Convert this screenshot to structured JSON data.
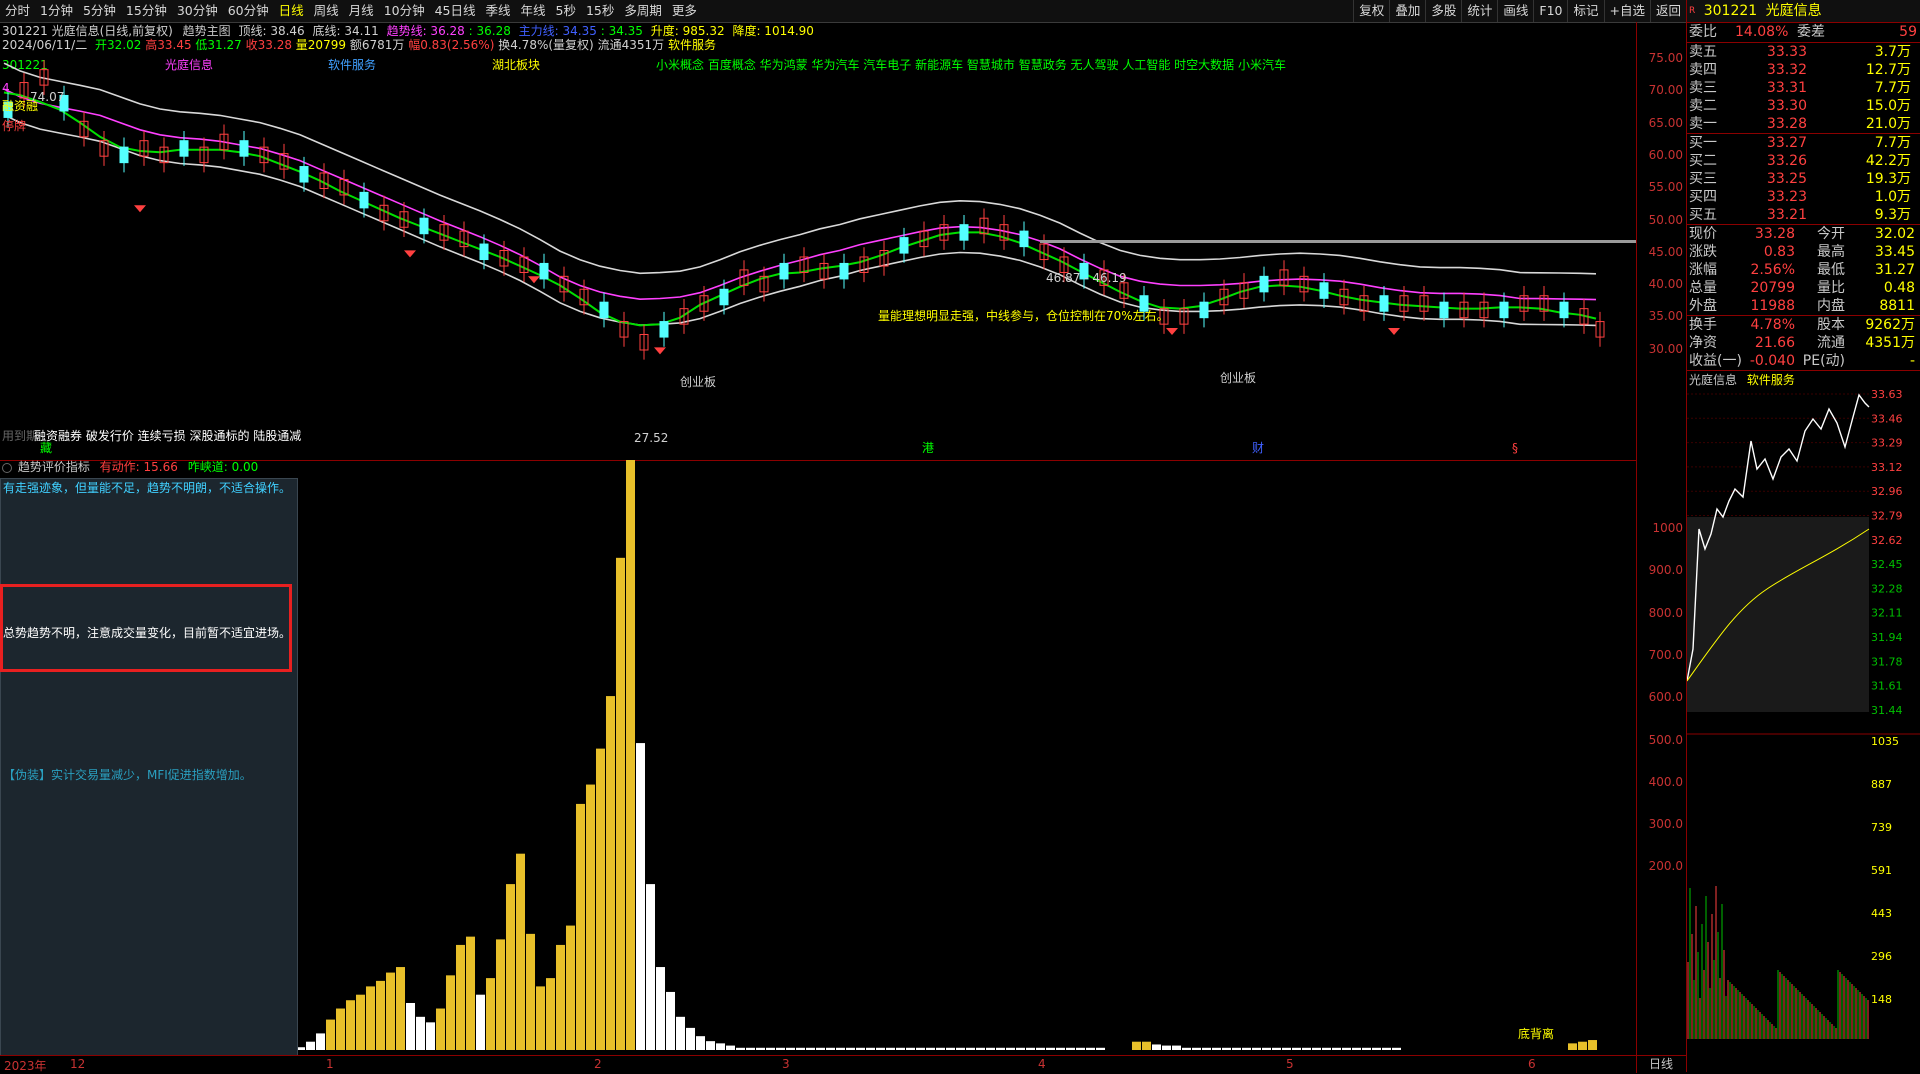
{
  "toolbar": {
    "periods": [
      "分时",
      "1分钟",
      "5分钟",
      "15分钟",
      "30分钟",
      "60分钟",
      "日线",
      "周线",
      "月线",
      "10分钟",
      "45日线",
      "季线",
      "年线",
      "5秒",
      "15秒",
      "多周期",
      "更多"
    ],
    "active_period": "日线",
    "right_buttons": [
      "复权",
      "叠加",
      "多股",
      "统计",
      "画线",
      "F10",
      "标记",
      "+自选",
      "返回"
    ]
  },
  "info": {
    "line1": {
      "code_name": "301221 光庭信息(日线,前复权)",
      "indicator": "趋势主图",
      "top_line": "顶线: 38.46",
      "bottom_line": "底线: 34.11",
      "trend_line": "趋势线: 36.28",
      "trend_line2": ": 36.28",
      "main_line": "主力线: 34.35",
      "main_line2": ": 34.35",
      "up_stop": "升度: 985.32",
      "down_stop": "降度: 1014.90"
    },
    "line2": {
      "date": "2024/06/11/二",
      "open": "开32.02",
      "high": "高33.45",
      "low": "低31.27",
      "close": "收33.28",
      "vol": "量20799",
      "amount": "额6781万",
      "change": "幅0.83(2.56%)",
      "turnover": "换4.78%(量复权)",
      "float": "流通4351万",
      "sector": "软件服务"
    },
    "tags_row": {
      "code": "301221",
      "name": "光庭信息",
      "sector": "软件服务",
      "region": "湖北板块",
      "concepts": "小米概念 百度概念 华为鸿蒙 华为汽车 汽车电子 新能源车 智慧城市 智慧政务 无人驾驶 人工智能 时空大数据 小米汽车"
    }
  },
  "chart_labels": {
    "high_mark": "74.07",
    "low_mark": "27.52",
    "range_mark": "46.87 - 46.19",
    "note1": "创业板",
    "note2": "创业板",
    "note3": "创业板",
    "tip_yellow": "量能理想明显走强，中线参与，仓位控制在70%左右。",
    "left_tag1": "融资融",
    "left_tag2": "停牌",
    "bottom_tags": "融资融券 破发行价 连续亏损 深股通标的 陆股通减",
    "bottom_tag_prefix": "用到期",
    "bottom_hk": "港",
    "bottom_cai": "财",
    "bottom_s": "§",
    "bottom_zang": "藏",
    "bottom_left_num": "4"
  },
  "price_axis": [
    "75.00",
    "70.00",
    "65.00",
    "60.00",
    "55.00",
    "50.00",
    "45.00",
    "40.00",
    "35.00",
    "30.00"
  ],
  "lower_axis": [
    "1000",
    "900.0",
    "800.0",
    "700.0",
    "600.0",
    "500.0",
    "400.0",
    "300.0",
    "200.0"
  ],
  "lower_header": {
    "title": "趋势评价指标",
    "active": "有动作: 15.66",
    "idle": "咋峡道: 0.00"
  },
  "eval_box": {
    "line1": "有走强迹象，但量能不足，趋势不明朗，不适合操作。",
    "line2": "总势趋势不明，注意成交量变化，目前暂不适宜进场。",
    "line3": "【伪装】实计交易量减少，MFI促进指数增加。"
  },
  "lower_note": "底背离",
  "date_axis": {
    "year": "2023年",
    "m12": "12",
    "m1": "1",
    "m2": "2",
    "m3": "3",
    "m4": "4",
    "m5": "5",
    "m6": "6",
    "right": "日线"
  },
  "right_panel": {
    "header_code": "301221",
    "header_name": "光庭信息",
    "webi_label": "委比",
    "webi_value": "14.08%",
    "weicha_label": "委差",
    "weicha_value": "59",
    "asks": [
      {
        "label": "卖五",
        "price": "33.33",
        "vol": "3.7万"
      },
      {
        "label": "卖四",
        "price": "33.32",
        "vol": "12.7万"
      },
      {
        "label": "卖三",
        "price": "33.31",
        "vol": "7.7万"
      },
      {
        "label": "卖二",
        "price": "33.30",
        "vol": "15.0万"
      },
      {
        "label": "卖一",
        "price": "33.28",
        "vol": "21.0万"
      }
    ],
    "bids": [
      {
        "label": "买一",
        "price": "33.27",
        "vol": "7.7万"
      },
      {
        "label": "买二",
        "price": "33.26",
        "vol": "42.2万"
      },
      {
        "label": "买三",
        "price": "33.25",
        "vol": "19.3万"
      },
      {
        "label": "买四",
        "price": "33.23",
        "vol": "1.0万"
      },
      {
        "label": "买五",
        "price": "33.21",
        "vol": "9.3万"
      }
    ],
    "stats": [
      {
        "l1": "现价",
        "v1": "33.28",
        "l2": "今开",
        "v2": "32.02"
      },
      {
        "l1": "涨跌",
        "v1": "0.83",
        "l2": "最高",
        "v2": "33.45"
      },
      {
        "l1": "涨幅",
        "v1": "2.56%",
        "l2": "最低",
        "v2": "31.27"
      },
      {
        "l1": "总量",
        "v1": "20799",
        "l2": "量比",
        "v2": "0.48"
      },
      {
        "l1": "外盘",
        "v1": "11988",
        "l2": "内盘",
        "v2": "8811"
      }
    ],
    "stats2": [
      {
        "l1": "换手",
        "v1": "4.78%",
        "l2": "股本",
        "v2": "9262万"
      },
      {
        "l1": "净资",
        "v1": "21.66",
        "l2": "流通",
        "v2": "4351万"
      },
      {
        "l1": "收益(一)",
        "v1": "-0.040",
        "l2": "PE(动)",
        "v2": "-"
      }
    ],
    "mini_title": "光庭信息",
    "mini_sector": "软件服务",
    "mini_axis": [
      "33.63",
      "33.46",
      "33.29",
      "33.12",
      "32.96",
      "32.79",
      "32.62",
      "32.45",
      "32.28",
      "32.11",
      "31.94",
      "31.78",
      "31.61",
      "31.44"
    ],
    "mini_vol_axis": [
      "1035",
      "887",
      "739",
      "591",
      "443",
      "296",
      "148"
    ]
  },
  "colors": {
    "up": "#ff4040",
    "down": "#54ffff",
    "yellow": "#ffff00",
    "trend": "#00ff00",
    "magenta": "#ff40ff",
    "white": "#ffffff",
    "gold": "#e8c02a"
  }
}
